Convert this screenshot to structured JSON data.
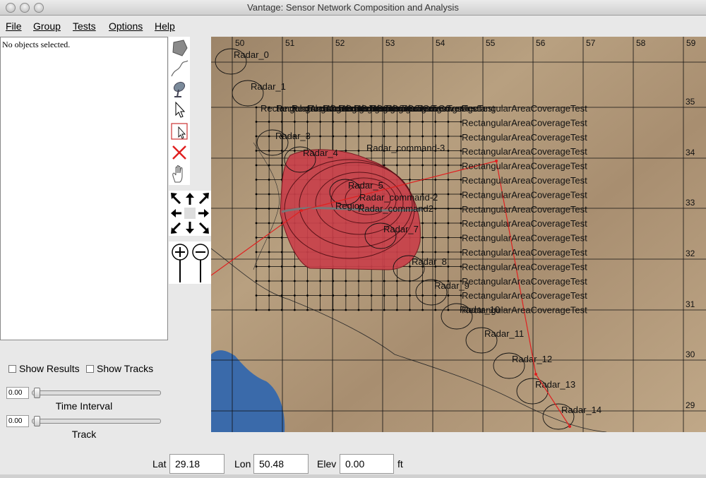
{
  "window": {
    "title": "Vantage: Sensor Network Composition and Analysis"
  },
  "menu": [
    "File",
    "Group",
    "Tests",
    "Options",
    "Help"
  ],
  "info_panel": {
    "text": "No objects selected."
  },
  "tools": [
    "polygon-tool-icon",
    "path-tool-icon",
    "sensor-tool-icon",
    "select-arrow-icon",
    "rectangle-select-icon",
    "delete-x-icon",
    "pan-hand-icon"
  ],
  "options": {
    "show_results_label": "Show Results",
    "show_tracks_label": "Show Tracks",
    "show_results_checked": false,
    "show_tracks_checked": false
  },
  "sliders": {
    "time_interval": {
      "value": "0.00",
      "label": "Time Interval"
    },
    "track": {
      "value": "0.00",
      "label": "Track"
    }
  },
  "coords": {
    "lat_label": "Lat",
    "lat_value": "29.18",
    "lon_label": "Lon",
    "lon_value": "50.48",
    "elev_label": "Elev",
    "elev_value": "0.00",
    "unit": "ft"
  },
  "map": {
    "lon_ticks": [
      "50",
      "51",
      "52",
      "53",
      "54",
      "55",
      "56",
      "57",
      "58",
      "59"
    ],
    "lat_ticks": [
      "35",
      "34",
      "33",
      "32",
      "31",
      "30",
      "29"
    ],
    "radars": [
      "Radar_0",
      "Radar_1",
      "Radar_3",
      "Radar_4",
      "Radar_5",
      "Radar_7",
      "Radar_8",
      "Radar_9",
      "Radar_10",
      "Radar_11",
      "Radar_12",
      "Radar_13",
      "Radar_14"
    ],
    "commands": [
      "Radar_command-3",
      "Radar_command-2",
      "Radar_command2",
      "Region"
    ],
    "coverage_label": "RectangularAreaCoverageTest",
    "coverage_top_label": "RectangularAreaCoverageTest",
    "colors": {
      "terrain": "#b39a7a",
      "water": "#3a6aaa",
      "coverage": "#c8404a",
      "track": "#e02020",
      "grid": "#111111"
    }
  }
}
